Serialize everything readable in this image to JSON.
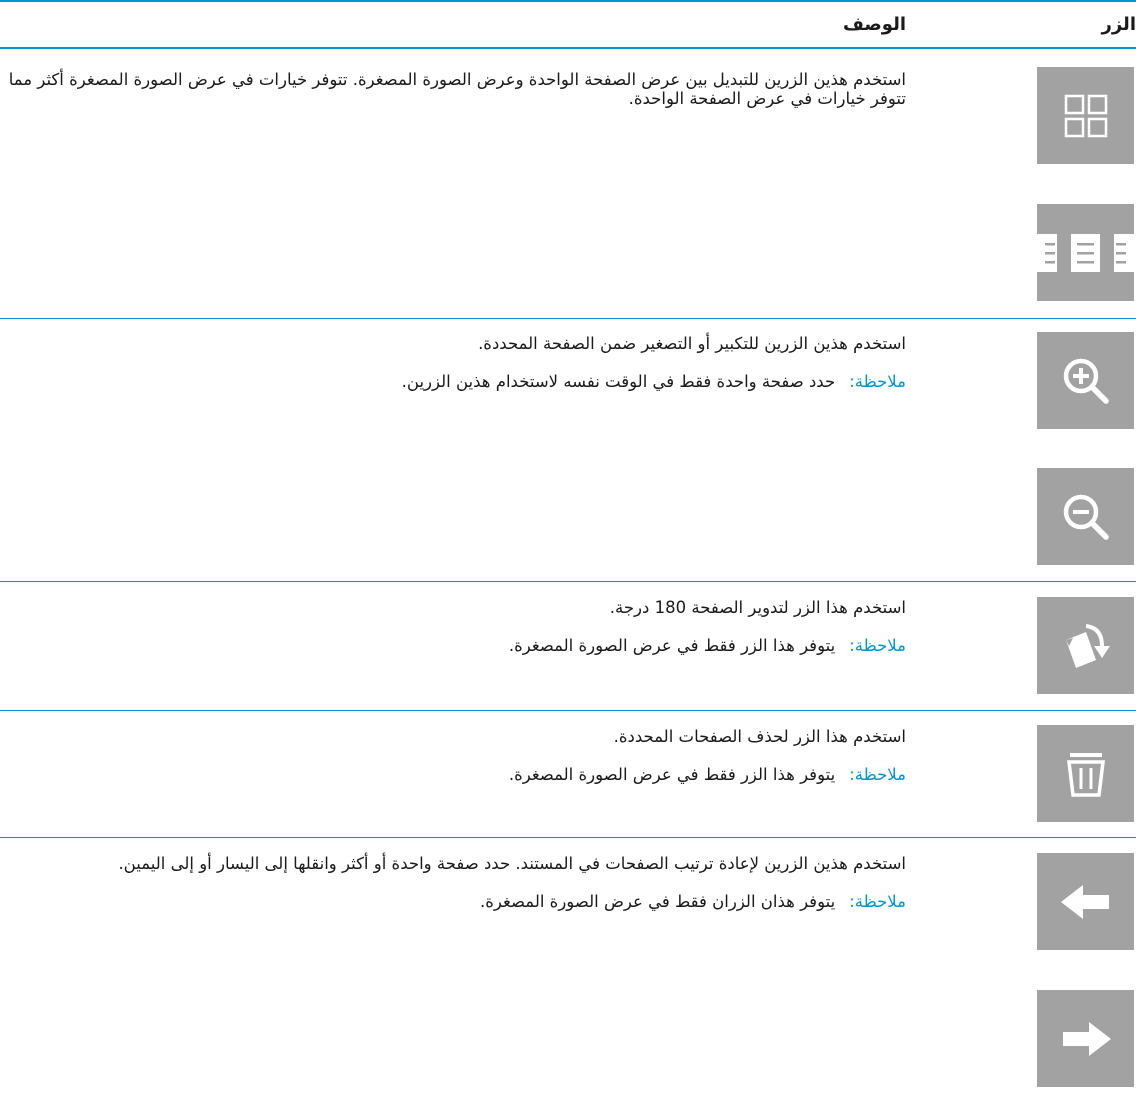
{
  "header": {
    "col_button": "الزر",
    "col_description": "الوصف"
  },
  "rows": [
    {
      "description": "استخدم هذين الزرين للتبديل بين عرض الصفحة الواحدة وعرض الصورة المصغرة. تتوفر خيارات في عرض الصورة المصغرة أكثر مما تتوفر خيارات في عرض الصفحة الواحدة.",
      "icons": [
        "thumbnail-grid-icon",
        "single-page-view-icon"
      ]
    },
    {
      "description": "استخدم هذين الزرين للتكبير أو التصغير ضمن الصفحة المحددة.",
      "note_label": "ملاحظة:",
      "note": "حدد صفحة واحدة فقط في الوقت نفسه لاستخدام هذين الزرين.",
      "icons": [
        "zoom-in-icon",
        "zoom-out-icon"
      ]
    },
    {
      "description": "استخدم هذا الزر لتدوير الصفحة 180 درجة.",
      "note_label": "ملاحظة:",
      "note": "يتوفر هذا الزر فقط في عرض الصورة المصغرة.",
      "icons": [
        "rotate-page-icon"
      ]
    },
    {
      "description": "استخدم هذا الزر لحذف الصفحات المحددة.",
      "note_label": "ملاحظة:",
      "note": "يتوفر هذا الزر فقط في عرض الصورة المصغرة.",
      "icons": [
        "trash-icon"
      ]
    },
    {
      "description": "استخدم هذين الزرين لإعادة ترتيب الصفحات في المستند. حدد صفحة واحدة أو أكثر وانقلها إلى اليسار أو إلى اليمين.",
      "note_label": "ملاحظة:",
      "note": "يتوفر هذان الزران فقط في عرض الصورة المصغرة.",
      "icons": [
        "arrow-left-icon",
        "arrow-right-icon"
      ]
    }
  ],
  "colors": {
    "accent": "#0096d6",
    "icon_bg": "#a2a2a2",
    "icon_fg": "#ffffff"
  }
}
